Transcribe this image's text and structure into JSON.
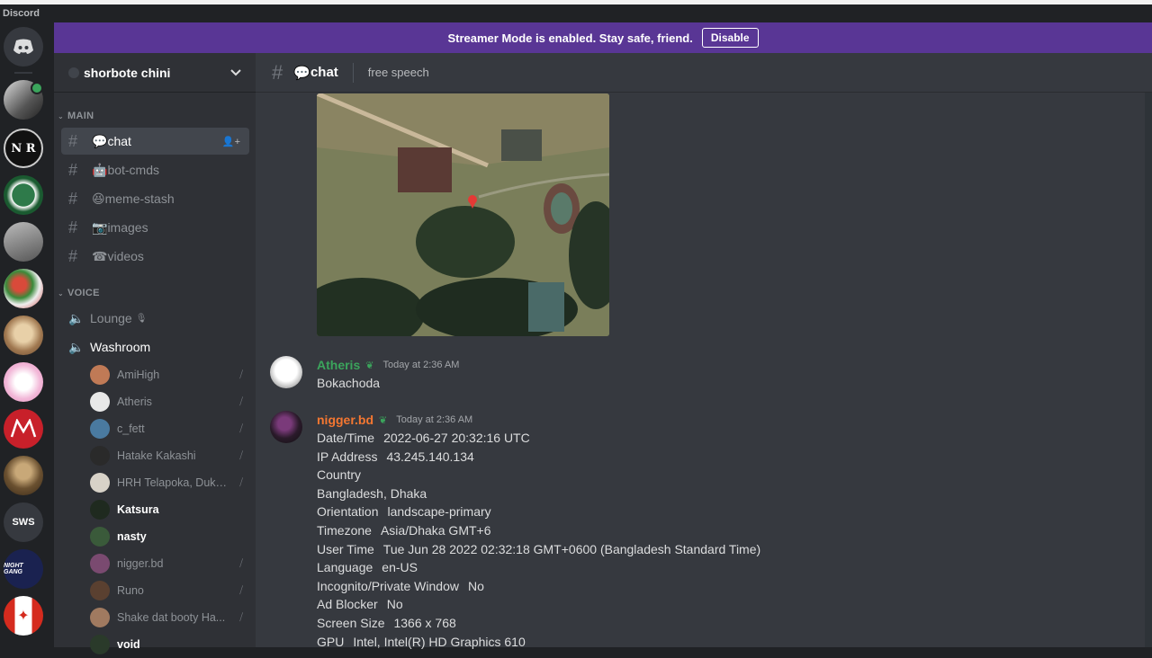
{
  "app": {
    "wordmark": "Discord"
  },
  "banner": {
    "text": "Streamer Mode is enabled. Stay safe, friend.",
    "button": "Disable"
  },
  "server": {
    "name": "shorbote chini"
  },
  "categories": {
    "main": "MAIN",
    "voice": "VOICE"
  },
  "channels": [
    {
      "emoji": "💬",
      "name": "chat",
      "active": true
    },
    {
      "emoji": "🤖",
      "name": "bot-cmds"
    },
    {
      "emoji": "😆",
      "name": "meme-stash"
    },
    {
      "emoji": "📷",
      "name": "images"
    },
    {
      "emoji": "☎",
      "name": "videos"
    }
  ],
  "voice_channels": [
    {
      "name": "Lounge"
    },
    {
      "name": "Washroom"
    }
  ],
  "voice_users": [
    {
      "name": "AmiHigh",
      "color": "#c07a56"
    },
    {
      "name": "Atheris",
      "color": "#e8e8e8"
    },
    {
      "name": "c_fett",
      "color": "#4a7aa0"
    },
    {
      "name": "Hatake Kakashi",
      "color": "#2a2a2a"
    },
    {
      "name": "HRH Telapoka, Duke of ...",
      "color": "#d8d2c8"
    },
    {
      "name": "Katsura",
      "color": "#1f2a1f"
    },
    {
      "name": "nasty",
      "color": "#3a5a3a"
    },
    {
      "name": "nigger.bd",
      "color": "#7a4a70"
    },
    {
      "name": "Runo",
      "color": "#5a4030"
    },
    {
      "name": "Shake dat booty Ha...",
      "color": "#a07a60"
    },
    {
      "name": "void",
      "color": "#2a3a2a"
    }
  ],
  "header": {
    "channel": "chat",
    "emoji": "💬",
    "topic": "free speech"
  },
  "messages": [
    {
      "author": "Atheris",
      "color": "#3ba55c",
      "time": "Today at 2:36 AM",
      "lines": [
        "Bokachoda"
      ]
    },
    {
      "author": "nigger.bd",
      "color": "#f57731",
      "time": "Today at 2:36 AM",
      "lines": [
        [
          "Date/Time",
          "2022-06-27 20:32:16 UTC"
        ],
        [
          "IP Address",
          "43.245.140.134"
        ],
        [
          "Country",
          ""
        ],
        [
          "Bangladesh, Dhaka",
          ""
        ],
        [
          "Orientation",
          "landscape-primary"
        ],
        [
          "Timezone",
          "Asia/Dhaka GMT+6"
        ],
        [
          "User Time",
          "Tue Jun 28 2022 02:32:18 GMT+0600 (Bangladesh Standard Time)"
        ],
        [
          "Language",
          "en-US"
        ],
        [
          "Incognito/Private Window",
          "No"
        ],
        [
          "Ad Blocker",
          "No"
        ],
        [
          "Screen Size",
          "1366 x 768"
        ],
        [
          "GPU",
          "Intel, Intel(R) HD Graphics 610"
        ]
      ]
    }
  ],
  "guild_labels": {
    "sws": "SWS",
    "night": "NIGHT GANG"
  },
  "colors": {
    "blurple": "#593695",
    "bg": "#36393f",
    "sidebar": "#2f3136",
    "guilds": "#202225"
  }
}
